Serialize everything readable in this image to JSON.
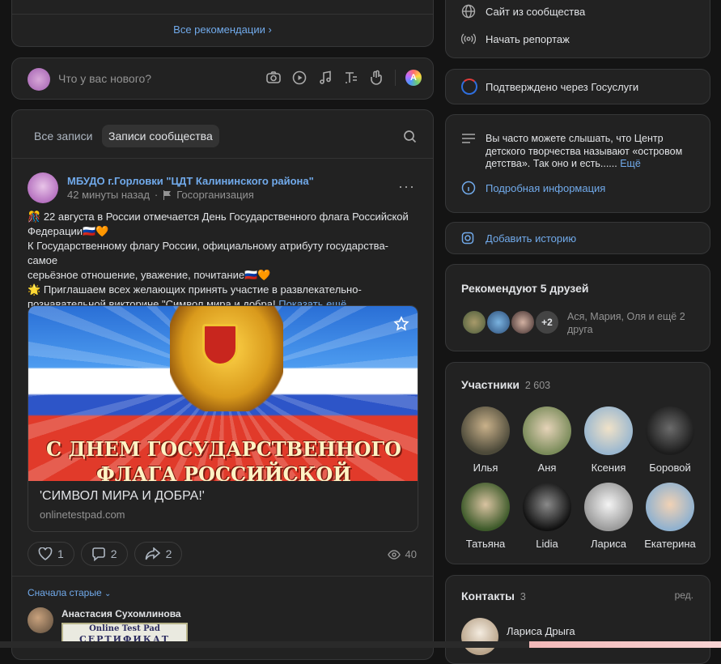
{
  "recommendations": {
    "all_label": "Все рекомендации"
  },
  "composer": {
    "placeholder": "Что у вас нового?"
  },
  "tabs": {
    "all_posts": "Все записи",
    "community_posts": "Записи сообщества"
  },
  "post": {
    "author": "МБУДО г.Горловки \"ЦДТ Калининского района\"",
    "time": "42 минуты назад",
    "category": "Госорганизация",
    "lines": [
      "22 августа в России отмечается День Государственного флага Российской",
      "Федерации",
      "К Государственному флагу России, официальному атрибуту государства- самое",
      "серьёзное отношение, уважение, почитание",
      "Приглашаем всех желающих принять участие в развлекательно-",
      "познавательной викторине \"Символ мира и добра!"
    ],
    "show_more": "Показать ещё",
    "banner_text_1": "С ДНЕМ ГОСУДАРСТВЕННОГО",
    "banner_text_2": "ФЛАГА РОССИЙСКОЙ ФЕДЕРАЦИИ",
    "link_title": "'СИМВОЛ МИРА И ДОБРА!'",
    "link_domain": "onlinetestpad.com",
    "likes": "1",
    "comments": "2",
    "shares": "2",
    "views": "40"
  },
  "comments_section": {
    "sort_label": "Сначала старые",
    "first_author": "Анастасия Сухомлинова",
    "certificate_line1": "Online Test Pad",
    "certificate_line2": "СЕРТИФИКАТ"
  },
  "sidebar": {
    "actions": [
      {
        "label": "Сайт из сообщества",
        "icon": "globe-icon"
      },
      {
        "label": "Начать репортаж",
        "icon": "broadcast-icon"
      }
    ],
    "gosuslugi": "Подтверждено через Госуслуги",
    "description": "Вы часто можете слышать, что Центр детского творчества называют «островом детства». Так оно и есть......",
    "description_more": "Ещё",
    "details_label": "Подробная информация",
    "add_story": "Добавить историю",
    "friends_title": "Рекомендуют 5 друзей",
    "friends_more_count": "+2",
    "friends_text": "Ася, Мария, Оля и ещё 2 друга",
    "members_title": "Участники",
    "members_count": "2 603",
    "members": [
      {
        "name": "Илья"
      },
      {
        "name": "Аня"
      },
      {
        "name": "Ксения"
      },
      {
        "name": "Боровой"
      },
      {
        "name": "Татьяна"
      },
      {
        "name": "Lidia"
      },
      {
        "name": "Лариса"
      },
      {
        "name": "Екатерина"
      }
    ],
    "contacts_title": "Контакты",
    "contacts_count": "3",
    "contacts_edit": "ред.",
    "contact_name": "Лариса Дрыга"
  },
  "colors": {
    "accent": "#71aaeb",
    "card_bg": "#222222",
    "page_bg": "#141414"
  }
}
